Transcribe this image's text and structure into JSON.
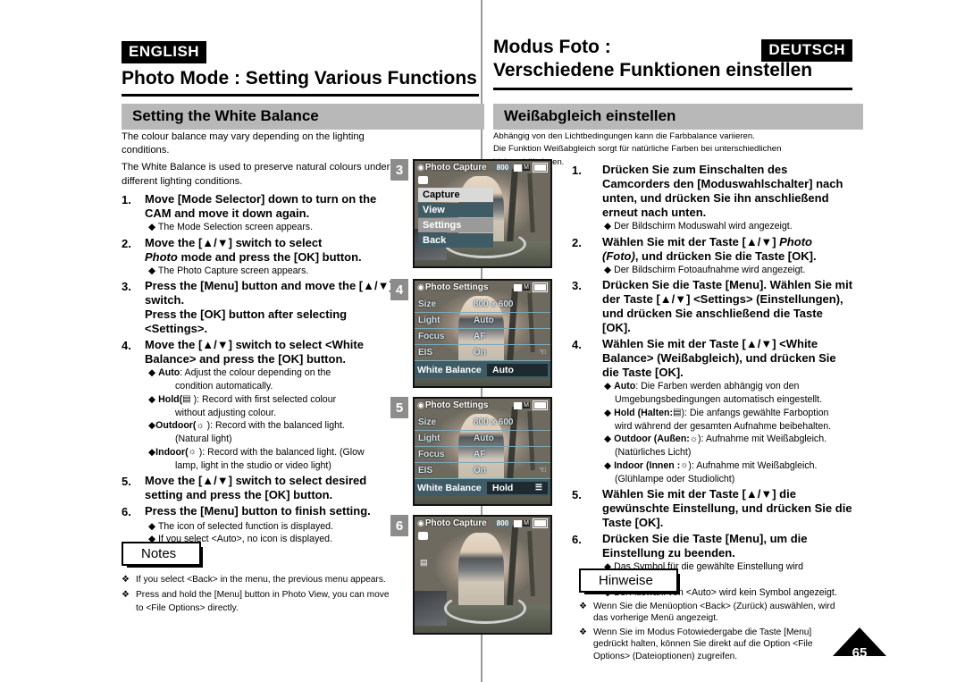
{
  "left": {
    "lang_badge": "ENGLISH",
    "title": "Photo Mode : Setting Various Functions",
    "section": "Setting the White Balance",
    "lead1": "The colour balance may vary depending on the lighting conditions.",
    "lead2": "The White Balance is used to preserve natural colours under different lighting conditions.",
    "steps": [
      {
        "num": "1.",
        "text": "Move [Mode Selector] down to turn on the CAM and move it down again."
      },
      {
        "num": "2.",
        "text": "Move the [▲/▼] switch to select "
      },
      {
        "num": "3.",
        "text": "Press the [Menu] button and move the [▲/▼] switch."
      },
      {
        "num": "4.",
        "text": "Move the [▲/▼] switch to select <White Balance> and press the [OK] button."
      },
      {
        "num": "5.",
        "text": "Move the [▲/▼] switch to select desired setting and press the [OK] button."
      },
      {
        "num": "6.",
        "text": "Press the [Menu] button to finish setting."
      }
    ],
    "step2_italic": "Photo",
    "step2_tail": " mode and press the [OK] button.",
    "step3_extra": "Press the [OK] button after selecting <Settings>.",
    "sub_after_1": "The Mode Selection screen appears.",
    "sub_after_2": "The Photo Capture screen appears.",
    "wb_options": [
      {
        "name": "Auto",
        "icon": "",
        "desc": ": Adjust the colour depending on the",
        "cont": "condition automatically."
      },
      {
        "name": "Hold(",
        "icon": "☰",
        "desc": " ): Record with first selected colour",
        "cont": "without adjusting colour."
      },
      {
        "name": "Outdoor(",
        "icon": "☀",
        "desc": " ):  Record with the balanced light.",
        "cont": "(Natural light)"
      },
      {
        "name": "Indoor(",
        "icon": "☀",
        "desc": " ): Record with the balanced light. (Glow",
        "cont": "lamp, light in the studio or video light)"
      }
    ],
    "sub_after_6a": "The icon of selected function is displayed.",
    "sub_after_6b": "If you select <Auto>, no icon is displayed.",
    "notes_title": "Notes",
    "notes": [
      "If you select <Back> in the menu, the previous menu appears.",
      "Press and hold the [Menu] button in Photo View, you can move to <File Options> directly."
    ]
  },
  "right": {
    "lang_badge": "DEUTSCH",
    "title_line1": "Modus Foto :",
    "title_line2": "Verschiedene Funktionen einstellen",
    "section": "Weißabgleich einstellen",
    "lead1": "Abhängig von den Lichtbedingungen kann die Farbbalance variieren.",
    "lead2": "Die Funktion Weißabgleich sorgt für natürliche Farben bei unterschiedlichen Lichtverhältnissen.",
    "steps": [
      {
        "num": "1.",
        "text": "Drücken Sie zum Einschalten des Camcorders den [Moduswahlschalter] nach unten, und drücken Sie ihn anschließend erneut nach unten."
      },
      {
        "num": "2.",
        "text": "Wählen Sie mit der Taste [▲/▼] "
      },
      {
        "num": "3.",
        "text": "Drücken Sie die Taste [Menu]. Wählen Sie mit der Taste [▲/▼] <Settings> (Einstellungen), und drücken Sie anschließend die Taste [OK]."
      },
      {
        "num": "4.",
        "text": "Wählen Sie mit der Taste [▲/▼] <White Balance> (Weißabgleich), und drücken Sie die Taste [OK]."
      },
      {
        "num": "5.",
        "text": "Wählen Sie mit der Taste [▲/▼]  die gewünschte Einstellung, und drücken Sie die Taste [OK]."
      },
      {
        "num": "6.",
        "text": "Drücken Sie die Taste [Menu], um die Einstellung zu beenden."
      }
    ],
    "step2_italic": "Photo",
    "step2_italic2": "(Foto)",
    "step2_tail": ", und drücken Sie die Taste [OK].",
    "sub_after_1": "Der Bildschirm Moduswahl wird angezeigt.",
    "sub_after_2": "Der Bildschirm Fotoaufnahme wird angezeigt.",
    "wb_options": [
      {
        "name": "Auto",
        "desc": ": Die Farben werden abhängig von den",
        "cont": "Umgebungsbedingungen automatisch eingestellt."
      },
      {
        "name": "Hold (Halten:",
        "icon": "☰",
        "desc": "): Die anfangs gewählte Farboption",
        "cont": "wird während der gesamten Aufnahme beibehalten."
      },
      {
        "name": "Outdoor (Außen:",
        "icon": "☀",
        "desc": "): Aufnahme mit Weißabgleich.",
        "cont": "(Natürliches Licht)"
      },
      {
        "name": "Indoor (Innen :",
        "icon": "☀",
        "desc": "): Aufnahme mit Weißabgleich.",
        "cont": "(Glühlampe oder Studiolicht)"
      }
    ],
    "sub_after_6a": "Das Symbol für die gewählte Einstellung wird eingeblendet.",
    "sub_after_6b": "Bei Auswahl von <Auto> wird kein Symbol angezeigt.",
    "notes_title": "Hinweise",
    "notes": [
      "Wenn Sie die Menüoption <Back> (Zurück) auswählen, wird das vorherige Menü angezeigt.",
      "Wenn Sie im Modus Fotowiedergabe die Taste [Menu] gedrückt halten, können Sie direkt auf die Option <File Options> (Dateioptionen) zugreifen."
    ]
  },
  "screens": [
    {
      "step": "3",
      "type": "menu",
      "title": "Photo Capture",
      "pixels": "800",
      "menu_items": [
        {
          "label": "Capture",
          "state": "selected"
        },
        {
          "label": "View",
          "state": "normal"
        },
        {
          "label": "Settings",
          "state": "gray"
        },
        {
          "label": "Back",
          "state": "normal"
        }
      ]
    },
    {
      "step": "4",
      "type": "settings",
      "title": "Photo Settings",
      "rows": [
        {
          "label": "Size",
          "value": "800 x 600"
        },
        {
          "label": "Light",
          "value": "Auto"
        },
        {
          "label": "Focus",
          "value": "AF"
        },
        {
          "label": "EIS",
          "value": "On"
        }
      ],
      "wb_label": "White Balance",
      "wb_value": "Auto",
      "wb_icon": ""
    },
    {
      "step": "5",
      "type": "settings",
      "title": "Photo Settings",
      "rows": [
        {
          "label": "Size",
          "value": "800 x 600"
        },
        {
          "label": "Light",
          "value": "Auto"
        },
        {
          "label": "Focus",
          "value": "AF"
        },
        {
          "label": "EIS",
          "value": "On"
        }
      ],
      "wb_label": "White Balance",
      "wb_value": "Hold",
      "wb_icon": "☰"
    },
    {
      "step": "6",
      "type": "capture",
      "title": "Photo Capture",
      "pixels": "800"
    }
  ],
  "page_number": "65",
  "colors": {
    "section_bar": "#b8b8b8",
    "badge_bg": "#000000",
    "chip_bg": "#8c8c8c",
    "menu_selected": "#d9d9d9",
    "menu_normal": "#3f5b66"
  }
}
